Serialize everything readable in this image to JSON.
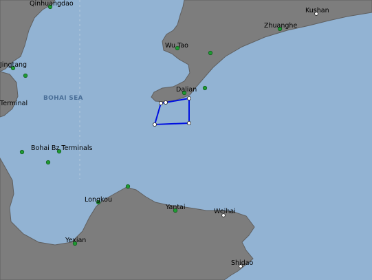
{
  "colors": {
    "sea": "#92b3d3",
    "land": "#7d7d7d",
    "coast": "#5f5f5f",
    "port": "#1f9a33",
    "poly": "#0010e0"
  },
  "sea_label": "BOHAI SEA",
  "ports": [
    {
      "id": "qinhuangdao",
      "label": "Qinhuangdao"
    },
    {
      "id": "kushan",
      "label": "Kushan"
    },
    {
      "id": "zhuanghe",
      "label": "Zhuanghe"
    },
    {
      "id": "wutao",
      "label": "Wu Tao"
    },
    {
      "id": "jingtang",
      "label": "Jingtang"
    },
    {
      "id": "dalian",
      "label": "Dalian"
    },
    {
      "id": "terminal",
      "label": "Terminal"
    },
    {
      "id": "bohaibz",
      "label": "Bohai Bz Terminals"
    },
    {
      "id": "longkou",
      "label": "Longkou"
    },
    {
      "id": "yantai",
      "label": "Yantai"
    },
    {
      "id": "weihai",
      "label": "Weihai"
    },
    {
      "id": "yexian",
      "label": "Yexian"
    },
    {
      "id": "shidao",
      "label": "Shidao"
    }
  ]
}
